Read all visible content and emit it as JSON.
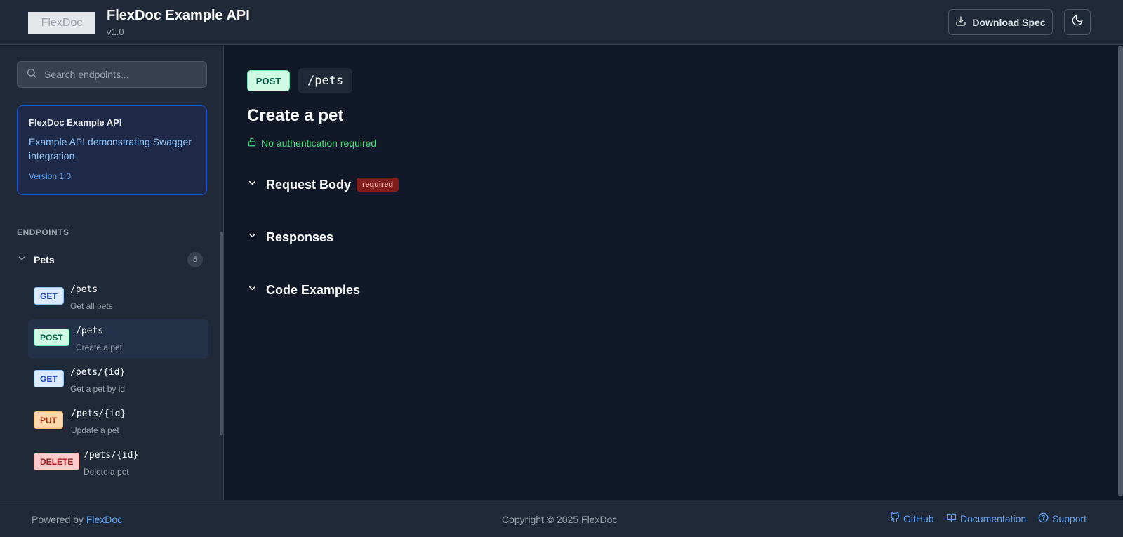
{
  "header": {
    "logo_text": "FlexDoc",
    "title": "FlexDoc Example API",
    "version": "v1.0",
    "download_label": "Download Spec"
  },
  "sidebar": {
    "search_placeholder": "Search endpoints...",
    "info": {
      "title": "FlexDoc Example API",
      "description": "Example API demonstrating Swagger integration",
      "version": "Version 1.0"
    },
    "endpoints_label": "ENDPOINTS",
    "group": {
      "name": "Pets",
      "count": "5"
    },
    "endpoints": [
      {
        "method": "GET",
        "path": "/pets",
        "summary": "Get all pets"
      },
      {
        "method": "POST",
        "path": "/pets",
        "summary": "Create a pet"
      },
      {
        "method": "GET",
        "path": "/pets/{id}",
        "summary": "Get a pet by id"
      },
      {
        "method": "PUT",
        "path": "/pets/{id}",
        "summary": "Update a pet"
      },
      {
        "method": "DELETE",
        "path": "/pets/{id}",
        "summary": "Delete a pet"
      }
    ]
  },
  "main": {
    "method": "POST",
    "path": "/pets",
    "title": "Create a pet",
    "auth": "No authentication required",
    "sections": {
      "request_body": "Request Body",
      "required_badge": "required",
      "responses": "Responses",
      "code_examples": "Code Examples"
    }
  },
  "footer": {
    "powered_prefix": "Powered by",
    "powered_link": "FlexDoc",
    "copyright": "Copyright © 2025 FlexDoc",
    "github": "GitHub",
    "documentation": "Documentation",
    "support": "Support"
  },
  "colors": {
    "background": "#111827",
    "panel": "#1f2937",
    "accent": "#60a5fa",
    "success": "#4ade80",
    "required": "#7f1d1d"
  }
}
